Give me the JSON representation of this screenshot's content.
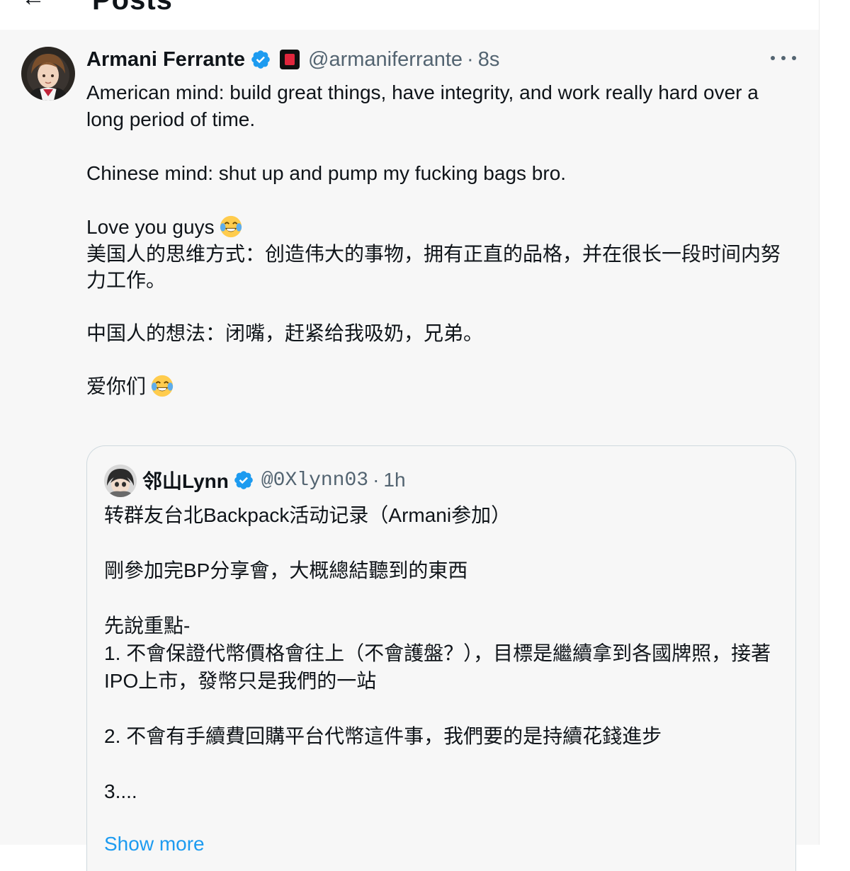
{
  "header": {
    "back_icon": "←",
    "title": "Posts"
  },
  "post": {
    "display_name": "Armani Ferrante",
    "handle": "@armaniferrante",
    "separator": "·",
    "time": "8s",
    "verified_icon": "verified-badge",
    "affiliation_icon": "affiliation-badge",
    "more_icon": "more-options",
    "text": {
      "p1": "American mind: build great things, have integrity, and work really hard over a long period of time.",
      "p2": "Chinese mind: shut up and pump my fucking bags bro.",
      "p3": "Love you guys",
      "p4": "美国人的思维方式：创造伟大的事物，拥有正直的品格，并在很长一段时间内努力工作。",
      "p5": "中国人的想法：闭嘴，赶紧给我吸奶，兄弟。",
      "p6": "爱你们"
    },
    "emoji": "tears-of-joy"
  },
  "quote": {
    "display_name": "邻山Lynn",
    "handle": "@0Xlynn03",
    "separator": "·",
    "time": "1h",
    "text": {
      "p1": "转群友台北Backpack活动记录（Armani参加）",
      "p2": "剛參加完BP分享會，大概總結聽到的東西",
      "p3": "先說重點-",
      "p4": "1. 不會保證代幣價格會往上（不會護盤？），目標是繼續拿到各國牌照，接著IPO上市，發幣只是我們的一站",
      "p5": "2. 不會有手續費回購平台代幣這件事，我們要的是持續花錢進步",
      "p6": "3...."
    },
    "show_more": "Show more"
  },
  "colors": {
    "link": "#1d9bf0",
    "verified": "#1d9bf0",
    "secondary_text": "#536471"
  }
}
